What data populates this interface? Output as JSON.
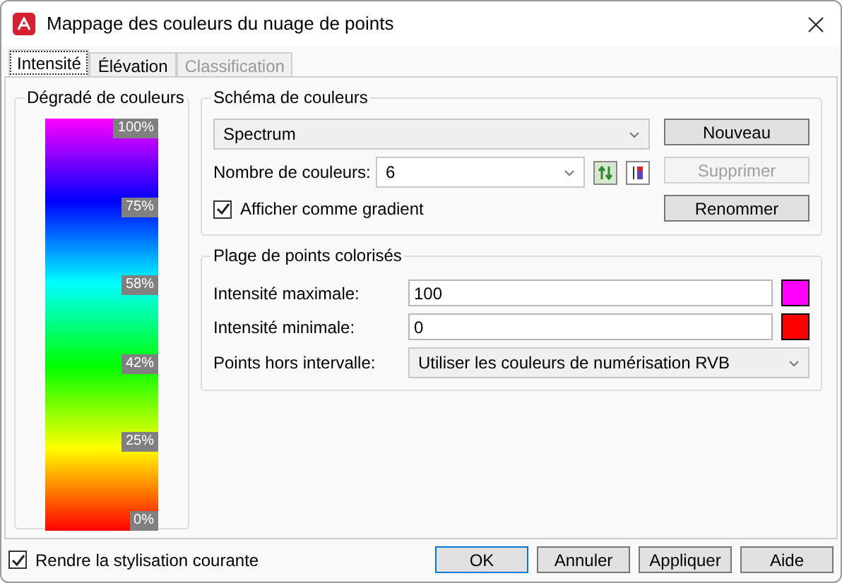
{
  "window": {
    "title": "Mappage des couleurs du nuage de points"
  },
  "tabs": [
    {
      "label": "Intensité",
      "selected": true,
      "disabled": false
    },
    {
      "label": "Élévation",
      "selected": false,
      "disabled": false
    },
    {
      "label": "Classification",
      "selected": false,
      "disabled": true
    }
  ],
  "gradient_panel": {
    "title": "Dégradé de couleurs",
    "stops": [
      {
        "label": "100%",
        "color": "#ff00ff"
      },
      {
        "label": "75%",
        "color": "#0000ff"
      },
      {
        "label": "58%",
        "color": "#00ffff"
      },
      {
        "label": "42%",
        "color": "#00ff00"
      },
      {
        "label": "25%",
        "color": "#ffff00"
      },
      {
        "label": "0%",
        "color": "#ff0000"
      }
    ]
  },
  "scheme": {
    "title": "Schéma de couleurs",
    "value": "Spectrum",
    "count_label": "Nombre de couleurs:",
    "count_value": "6",
    "show_gradient": {
      "label": "Afficher comme gradient",
      "checked": true
    },
    "buttons": [
      {
        "label": "Nouveau",
        "disabled": false
      },
      {
        "label": "Supprimer",
        "disabled": true
      },
      {
        "label": "Renommer",
        "disabled": false
      }
    ]
  },
  "range": {
    "title": "Plage de points colorisés",
    "fields": [
      {
        "label": "Intensité maximale:",
        "value": "100",
        "color": "#ff00ff"
      },
      {
        "label": "Intensité minimale:",
        "value": "0",
        "color": "#ff0000"
      }
    ],
    "out_label": "Points hors intervalle:",
    "out_value": "Utiliser les couleurs de numérisation RVB"
  },
  "footer": {
    "checkbox": {
      "label": "Rendre la stylisation courante",
      "checked": true
    },
    "buttons": [
      {
        "label": "OK",
        "default": true
      },
      {
        "label": "Annuler",
        "default": false
      },
      {
        "label": "Appliquer",
        "default": false
      },
      {
        "label": "Aide",
        "default": false
      }
    ]
  }
}
